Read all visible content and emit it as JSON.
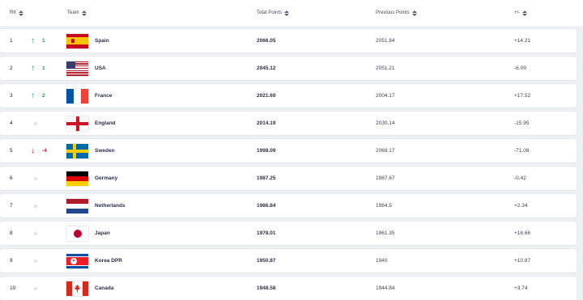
{
  "header": {
    "rk": "RK",
    "team": "Team",
    "total": "Total Points",
    "previous": "Previous Points",
    "diff": "+/-"
  },
  "rows": [
    {
      "rank": "1",
      "movement": "up",
      "change": "1",
      "team": "Spain",
      "flag": "spain-flag-icon",
      "total": "2066.05",
      "previous": "2051.84",
      "diff": "+14.21"
    },
    {
      "rank": "2",
      "movement": "up",
      "change": "1",
      "team": "USA",
      "flag": "usa-flag-icon",
      "total": "2045.12",
      "previous": "2051.21",
      "diff": "-6.09"
    },
    {
      "rank": "3",
      "movement": "up",
      "change": "2",
      "team": "France",
      "flag": "france-flag-icon",
      "total": "2021.69",
      "previous": "2004.17",
      "diff": "+17.52"
    },
    {
      "rank": "4",
      "movement": "none",
      "change": "",
      "team": "England",
      "flag": "england-flag-icon",
      "total": "2014.19",
      "previous": "2030.14",
      "diff": "-15.95"
    },
    {
      "rank": "5",
      "movement": "down",
      "change": "-4",
      "team": "Sweden",
      "flag": "sweden-flag-icon",
      "total": "1998.09",
      "previous": "2069.17",
      "diff": "-71.08"
    },
    {
      "rank": "6",
      "movement": "none",
      "change": "",
      "team": "Germany",
      "flag": "germany-flag-icon",
      "total": "1987.25",
      "previous": "1987.67",
      "diff": "-0.42"
    },
    {
      "rank": "7",
      "movement": "none",
      "change": "",
      "team": "Netherlands",
      "flag": "netherlands-flag-icon",
      "total": "1986.84",
      "previous": "1984.5",
      "diff": "+2.34"
    },
    {
      "rank": "8",
      "movement": "none",
      "change": "",
      "team": "Japan",
      "flag": "japan-flag-icon",
      "total": "1978.01",
      "previous": "1961.35",
      "diff": "+16.66"
    },
    {
      "rank": "9",
      "movement": "none",
      "change": "",
      "team": "Korea DPR",
      "flag": "korea-dpr-flag-icon",
      "total": "1950.87",
      "previous": "1940",
      "diff": "+10.87"
    },
    {
      "rank": "10",
      "movement": "none",
      "change": "",
      "team": "Canada",
      "flag": "canada-flag-icon",
      "total": "1948.58",
      "previous": "1944.84",
      "diff": "+3.74"
    }
  ],
  "colors": {
    "up": "#1a9e4b",
    "down": "#d2173a",
    "neutral_dot": "#dfe2e8"
  }
}
